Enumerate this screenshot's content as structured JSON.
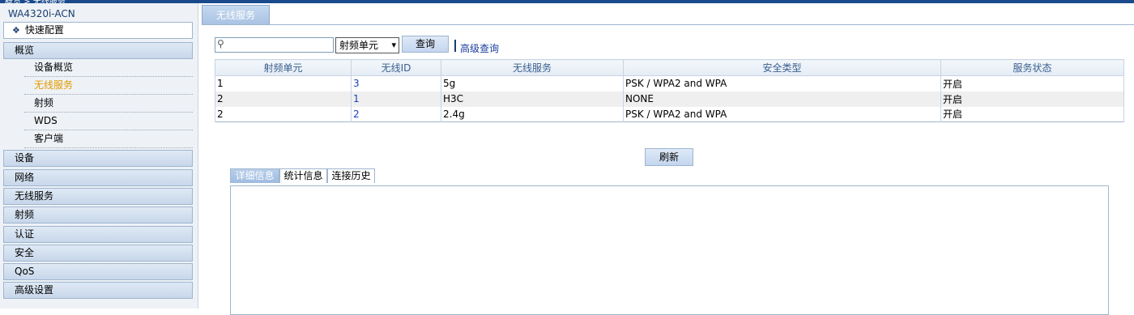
{
  "topbar": {
    "text": "概览 > 无线服务"
  },
  "sidebar": {
    "device_name": "WA4320i-ACN",
    "quick_config": "快速配置",
    "overview": "概览",
    "overview_items": [
      {
        "label": "设备概览",
        "active": false
      },
      {
        "label": "无线服务",
        "active": true
      },
      {
        "label": "射频",
        "active": false
      },
      {
        "label": "WDS",
        "active": false
      },
      {
        "label": "客户端",
        "active": false
      }
    ],
    "groups": [
      {
        "label": "设备"
      },
      {
        "label": "网络"
      },
      {
        "label": "无线服务"
      },
      {
        "label": "射频"
      },
      {
        "label": "认证"
      },
      {
        "label": "安全"
      },
      {
        "label": "QoS"
      },
      {
        "label": "高级设置"
      }
    ]
  },
  "main": {
    "tab": "无线服务",
    "search": {
      "value": "",
      "placeholder": ""
    },
    "filter_select": "射频单元",
    "query_button": "查询",
    "advanced_query": "高级查询",
    "table": {
      "headers": [
        "射频单元",
        "无线ID",
        "无线服务",
        "安全类型",
        "服务状态"
      ],
      "rows": [
        [
          "1",
          "3",
          "5g",
          "PSK / WPA2 and WPA",
          "开启"
        ],
        [
          "2",
          "1",
          "H3C",
          "NONE",
          "开启"
        ],
        [
          "2",
          "2",
          "2.4g",
          "PSK / WPA2 and WPA",
          "开启"
        ]
      ]
    },
    "refresh_button": "刷新",
    "detail_tabs": [
      {
        "label": "详细信息",
        "active": true
      },
      {
        "label": "统计信息",
        "active": false
      },
      {
        "label": "连接历史",
        "active": false
      }
    ]
  },
  "colors": {
    "accent": "#1a4a8c",
    "active_nav": "#e39a00",
    "link": "#1a3dbf"
  }
}
